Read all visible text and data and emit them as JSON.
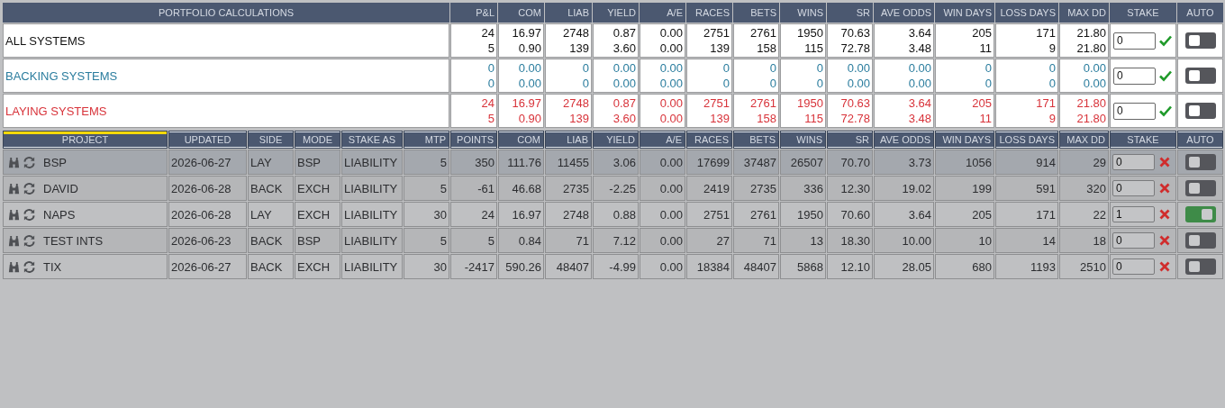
{
  "summary": {
    "title": "PORTFOLIO CALCULATIONS",
    "columns": [
      "P&L",
      "COM",
      "LIAB",
      "YIELD",
      "A/E",
      "RACES",
      "BETS",
      "WINS",
      "SR",
      "AVE ODDS",
      "WIN DAYS",
      "LOSS DAYS",
      "MAX DD",
      "STAKE",
      "AUTO"
    ],
    "rows": [
      {
        "kind": "all",
        "name": "ALL SYSTEMS",
        "values": [
          [
            "24",
            "5"
          ],
          [
            "16.97",
            "0.90"
          ],
          [
            "2748",
            "139"
          ],
          [
            "0.87",
            "3.60"
          ],
          [
            "0.00",
            "0.00"
          ],
          [
            "2751",
            "139"
          ],
          [
            "2761",
            "158"
          ],
          [
            "1950",
            "115"
          ],
          [
            "70.63",
            "72.78"
          ],
          [
            "3.64",
            "3.48"
          ],
          [
            "205",
            "11"
          ],
          [
            "171",
            "9"
          ],
          [
            "21.80",
            "21.80"
          ]
        ],
        "stake": "0",
        "stake_valid": true,
        "auto": false
      },
      {
        "kind": "backing",
        "name": "BACKING SYSTEMS",
        "values": [
          [
            "0",
            "0"
          ],
          [
            "0.00",
            "0.00"
          ],
          [
            "0",
            "0"
          ],
          [
            "0.00",
            "0.00"
          ],
          [
            "0.00",
            "0.00"
          ],
          [
            "0",
            "0"
          ],
          [
            "0",
            "0"
          ],
          [
            "0",
            "0"
          ],
          [
            "0.00",
            "0.00"
          ],
          [
            "0.00",
            "0.00"
          ],
          [
            "0",
            "0"
          ],
          [
            "0",
            "0"
          ],
          [
            "0.00",
            "0.00"
          ]
        ],
        "stake": "0",
        "stake_valid": true,
        "auto": false
      },
      {
        "kind": "laying",
        "name": "LAYING SYSTEMS",
        "values": [
          [
            "24",
            "5"
          ],
          [
            "16.97",
            "0.90"
          ],
          [
            "2748",
            "139"
          ],
          [
            "0.87",
            "3.60"
          ],
          [
            "0.00",
            "0.00"
          ],
          [
            "2751",
            "139"
          ],
          [
            "2761",
            "158"
          ],
          [
            "1950",
            "115"
          ],
          [
            "70.63",
            "72.78"
          ],
          [
            "3.64",
            "3.48"
          ],
          [
            "205",
            "11"
          ],
          [
            "171",
            "9"
          ],
          [
            "21.80",
            "21.80"
          ]
        ],
        "stake": "0",
        "stake_valid": true,
        "auto": false
      }
    ]
  },
  "projects": {
    "columns": [
      {
        "label": "PROJECT",
        "sorted": true
      },
      {
        "label": "UPDATED",
        "sorted": false
      },
      {
        "label": "SIDE",
        "sorted": false
      },
      {
        "label": "MODE",
        "sorted": false
      },
      {
        "label": "STAKE AS",
        "sorted": false
      },
      {
        "label": "MTP",
        "sorted": false
      },
      {
        "label": "POINTS",
        "sorted": false
      },
      {
        "label": "COM",
        "sorted": false
      },
      {
        "label": "LIAB",
        "sorted": false
      },
      {
        "label": "YIELD",
        "sorted": false
      },
      {
        "label": "A/E",
        "sorted": false
      },
      {
        "label": "RACES",
        "sorted": false
      },
      {
        "label": "BETS",
        "sorted": false
      },
      {
        "label": "WINS",
        "sorted": false
      },
      {
        "label": "SR",
        "sorted": false
      },
      {
        "label": "AVE ODDS",
        "sorted": false
      },
      {
        "label": "WIN DAYS",
        "sorted": false
      },
      {
        "label": "LOSS DAYS",
        "sorted": false
      },
      {
        "label": "MAX DD",
        "sorted": false
      },
      {
        "label": "STAKE",
        "sorted": false
      },
      {
        "label": "AUTO",
        "sorted": false
      }
    ],
    "rows": [
      {
        "selected": true,
        "cells": [
          "BSP",
          "2026-06-27",
          "LAY",
          "BSP",
          "LIABILITY",
          "5",
          "350",
          "111.76",
          "11455",
          "3.06",
          "0.00",
          "17699",
          "37487",
          "26507",
          "70.70",
          "3.73",
          "1056",
          "914",
          "29"
        ],
        "stake": "0",
        "stake_valid": false,
        "auto": false
      },
      {
        "selected": false,
        "cells": [
          "DAVID",
          "2026-06-28",
          "BACK",
          "EXCH",
          "LIABILITY",
          "5",
          "-61",
          "46.68",
          "2735",
          "-2.25",
          "0.00",
          "2419",
          "2735",
          "336",
          "12.30",
          "19.02",
          "199",
          "591",
          "320"
        ],
        "stake": "0",
        "stake_valid": false,
        "auto": false
      },
      {
        "selected": false,
        "cells": [
          "NAPS",
          "2026-06-28",
          "LAY",
          "EXCH",
          "LIABILITY",
          "30",
          "24",
          "16.97",
          "2748",
          "0.88",
          "0.00",
          "2751",
          "2761",
          "1950",
          "70.60",
          "3.64",
          "205",
          "171",
          "22"
        ],
        "stake": "1",
        "stake_valid": false,
        "auto": true
      },
      {
        "selected": false,
        "cells": [
          "TEST INTS",
          "2026-06-23",
          "BACK",
          "BSP",
          "LIABILITY",
          "5",
          "5",
          "0.84",
          "71",
          "7.12",
          "0.00",
          "27",
          "71",
          "13",
          "18.30",
          "10.00",
          "10",
          "14",
          "18"
        ],
        "stake": "0",
        "stake_valid": false,
        "auto": false
      },
      {
        "selected": false,
        "cells": [
          "TIX",
          "2026-06-27",
          "BACK",
          "EXCH",
          "LIABILITY",
          "30",
          "-2417",
          "590.26",
          "48407",
          "-4.99",
          "0.00",
          "18384",
          "48407",
          "5868",
          "12.10",
          "28.05",
          "680",
          "1193",
          "2510"
        ],
        "stake": "0",
        "stake_valid": false,
        "auto": false
      }
    ]
  }
}
